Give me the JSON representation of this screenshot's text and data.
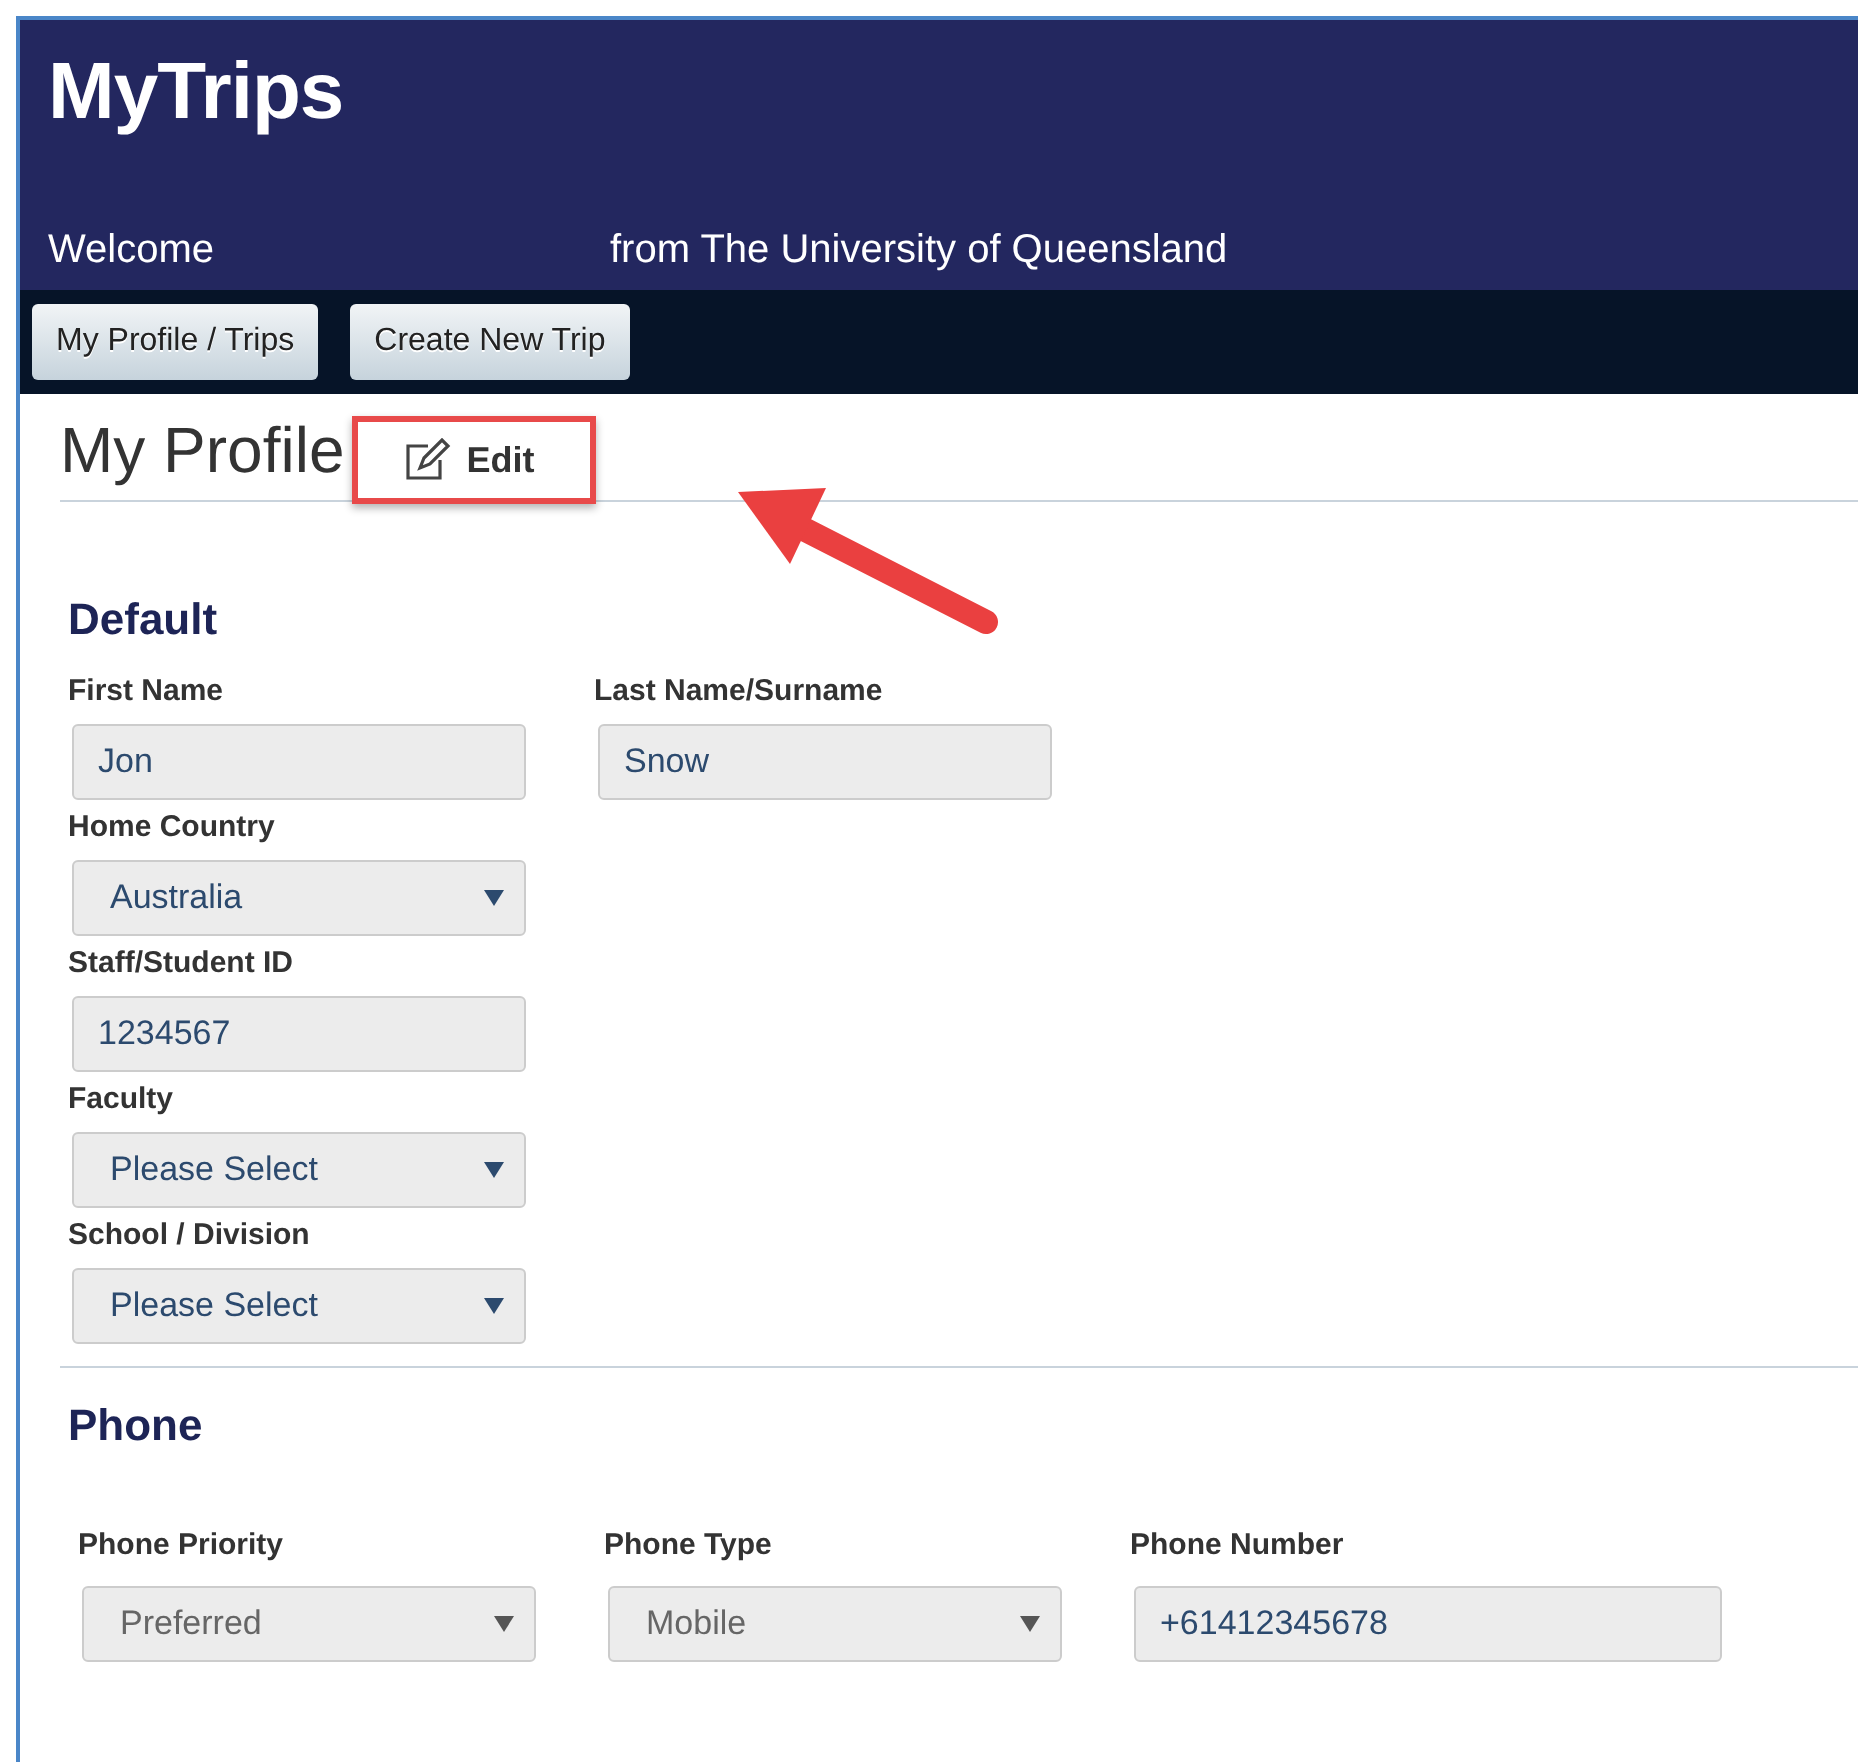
{
  "app": {
    "title": "MyTrips",
    "welcome": "Welcome",
    "affiliation": "from The University of Queensland"
  },
  "nav": [
    {
      "label": "My Profile / Trips"
    },
    {
      "label": "Create New Trip"
    }
  ],
  "page": {
    "title": "My Profile",
    "edit_button": "Edit",
    "highlighted": true
  },
  "sections": [
    {
      "title": "Default",
      "rows": [
        [
          {
            "label": "First Name",
            "kind": "text",
            "value": "Jon",
            "disabled": false
          },
          {
            "label": "Last Name/Surname",
            "kind": "text",
            "value": "Snow",
            "disabled": false
          }
        ],
        [
          {
            "label": "Home Country",
            "kind": "select",
            "value": "Australia",
            "disabled": false
          }
        ],
        [
          {
            "label": "Staff/Student ID",
            "kind": "text",
            "value": "1234567",
            "disabled": false
          }
        ],
        [
          {
            "label": "Faculty",
            "kind": "select",
            "value": "Please Select",
            "disabled": false
          }
        ],
        [
          {
            "label": "School / Division",
            "kind": "select",
            "value": "Please Select",
            "disabled": false
          }
        ]
      ]
    },
    {
      "title": "Phone",
      "rows": [
        [
          {
            "label": "Phone Priority",
            "kind": "select",
            "value": "Preferred",
            "disabled": true
          },
          {
            "label": "Phone Type",
            "kind": "select",
            "value": "Mobile",
            "disabled": true
          },
          {
            "label": "Phone Number",
            "kind": "text",
            "value": "+61412345678",
            "disabled": false
          }
        ]
      ]
    }
  ]
}
